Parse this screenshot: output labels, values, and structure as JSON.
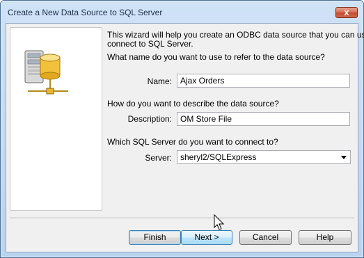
{
  "window": {
    "title": "Create a New Data Source to SQL Server",
    "close_glyph": "x"
  },
  "intro": {
    "line1": "This wizard will help you create an ODBC data source that you can use to",
    "line2": "connect to SQL Server."
  },
  "name_section": {
    "question": "What name do you want to use to refer to the data source?",
    "label": "Name:",
    "value": "Ajax Orders"
  },
  "description_section": {
    "question": "How do you want to describe the data source?",
    "label": "Description:",
    "value": "OM Store File"
  },
  "server_section": {
    "question": "Which SQL Server do you want to connect to?",
    "label": "Server:",
    "value": "sheryl2/SQLExpress"
  },
  "buttons": {
    "finish": "Finish",
    "next": "Next >",
    "cancel": "Cancel",
    "help": "Help"
  },
  "colors": {
    "accent": "#3c7fb1",
    "title_text": "#1e2f45",
    "close": "#c44a2f"
  }
}
